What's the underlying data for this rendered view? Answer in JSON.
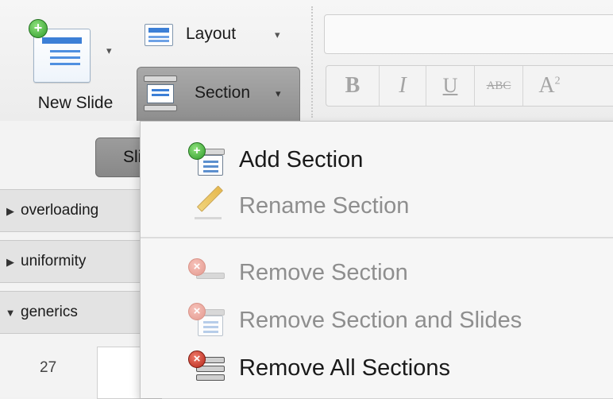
{
  "ribbon": {
    "new_slide_label": "New Slide",
    "layout_label": "Layout",
    "section_label": "Section",
    "dropdown_arrow": "▾",
    "format_buttons": [
      {
        "id": "bold",
        "label": "B",
        "icon": "bold-icon"
      },
      {
        "id": "italic",
        "label": "I",
        "icon": "italic-icon"
      },
      {
        "id": "underline",
        "label": "U",
        "icon": "underline-icon"
      },
      {
        "id": "strikethrough",
        "label": "ABC",
        "icon": "strikethrough-icon"
      },
      {
        "id": "superscript",
        "label": "A",
        "sup": "2",
        "icon": "superscript-icon"
      }
    ]
  },
  "pane": {
    "slides_tab_label": "Slides",
    "sections": [
      {
        "label": "overloading",
        "expanded": false
      },
      {
        "label": "uniformity",
        "expanded": false
      },
      {
        "label": "generics",
        "expanded": true
      }
    ],
    "slide_number": "27"
  },
  "menu": {
    "items": [
      {
        "label": "Add Section",
        "enabled": true,
        "icon": "add-section-icon"
      },
      {
        "label": "Rename Section",
        "enabled": false,
        "icon": "rename-pencil-icon"
      },
      {
        "label": "Remove Section",
        "enabled": false,
        "icon": "remove-section-icon"
      },
      {
        "label": "Remove Section and Slides",
        "enabled": false,
        "icon": "remove-section-slides-icon"
      },
      {
        "label": "Remove All Sections",
        "enabled": true,
        "icon": "remove-all-sections-icon"
      }
    ]
  },
  "colors": {
    "accent_blue": "#3c7fd6",
    "add_green": "#2f9b2a",
    "remove_red": "#b5271a",
    "disabled_text": "#8e8e8e"
  }
}
